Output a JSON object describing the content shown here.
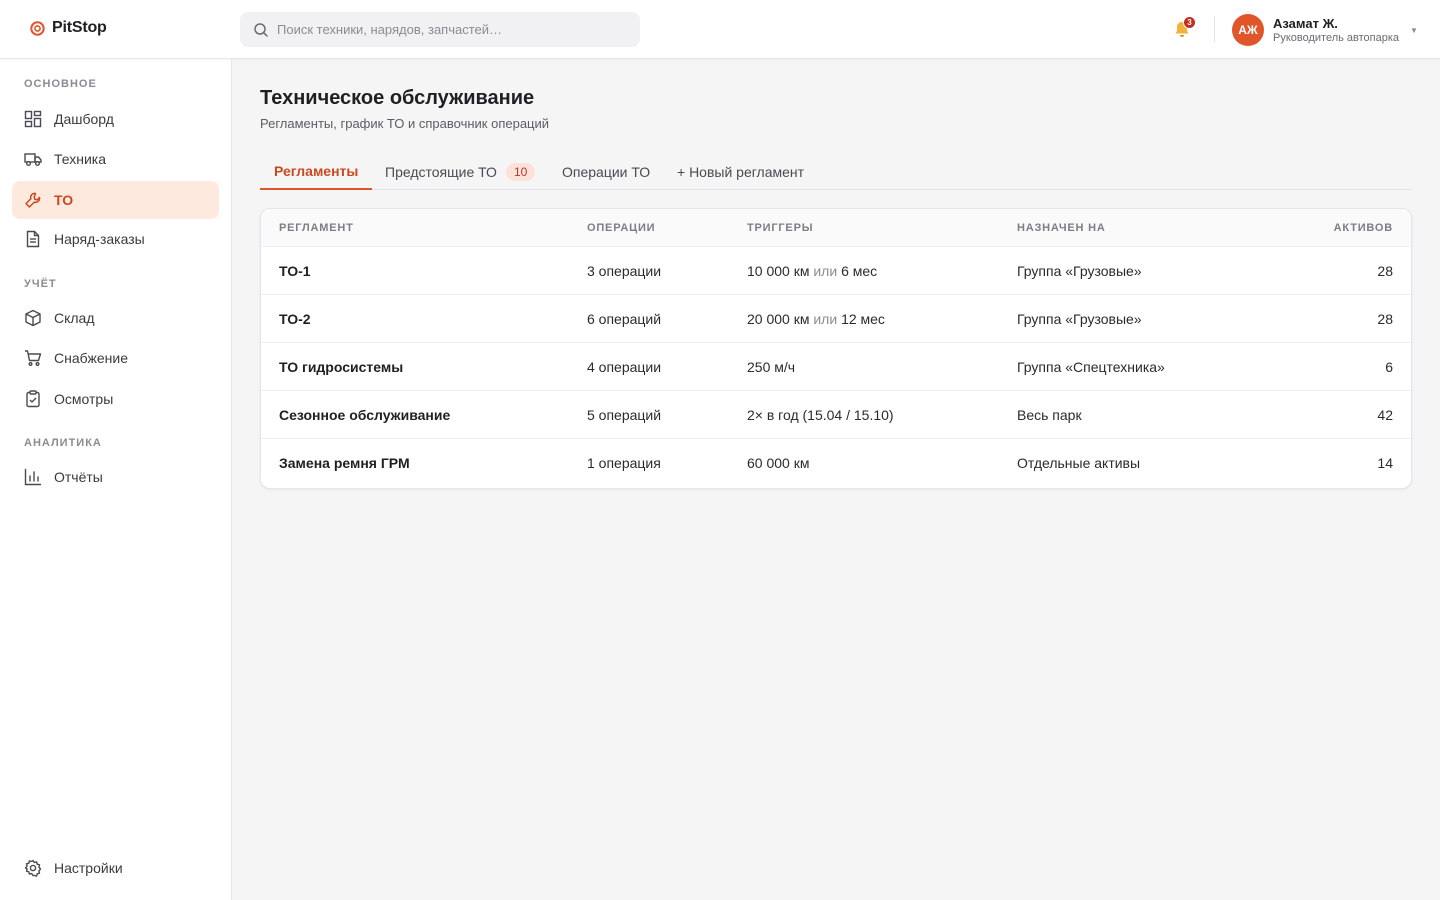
{
  "app": {
    "name": "PitStop",
    "accent": "#E0552A"
  },
  "search": {
    "placeholder": "Поиск техники, нарядов, запчастей…"
  },
  "notifications": {
    "count": "3"
  },
  "user": {
    "initials": "АЖ",
    "name": "Азамат Ж.",
    "role": "Руководитель автопарка"
  },
  "sidebar": {
    "sections": [
      {
        "title": "ОСНОВНОЕ",
        "items": [
          {
            "label": "Дашборд",
            "icon": "dashboard-icon"
          },
          {
            "label": "Техника",
            "icon": "truck-icon"
          },
          {
            "label": "ТО",
            "icon": "wrench-icon",
            "active": true
          },
          {
            "label": "Наряд-заказы",
            "icon": "document-icon"
          }
        ]
      },
      {
        "title": "УЧЁТ",
        "items": [
          {
            "label": "Склад",
            "icon": "box-icon"
          },
          {
            "label": "Снабжение",
            "icon": "cart-icon"
          },
          {
            "label": "Осмотры",
            "icon": "clipboard-check-icon"
          }
        ]
      },
      {
        "title": "АНАЛИТИКА",
        "items": [
          {
            "label": "Отчёты",
            "icon": "bar-chart-icon"
          }
        ]
      }
    ],
    "settings": {
      "label": "Настройки",
      "icon": "gear-icon"
    }
  },
  "page": {
    "title": "Техническое обслуживание",
    "subtitle": "Регламенты, график ТО и справочник операций"
  },
  "tabs": [
    {
      "label": "Регламенты",
      "active": true
    },
    {
      "label": "Предстоящие ТО",
      "badge": "10"
    },
    {
      "label": "Операции ТО"
    },
    {
      "label": "+ Новый регламент"
    }
  ],
  "table": {
    "headers": [
      "РЕГЛАМЕНТ",
      "ОПЕРАЦИИ",
      "ТРИГГЕРЫ",
      "НАЗНАЧЕН НА",
      "АКТИВОВ"
    ],
    "rows": [
      {
        "name": "ТО-1",
        "ops": "3 операции",
        "trigger_a": "10 000 км",
        "trigger_or": "или",
        "trigger_b": "6 мес",
        "assigned": "Группа «Грузовые»",
        "assets": "28"
      },
      {
        "name": "ТО-2",
        "ops": "6 операций",
        "trigger_a": "20 000 км",
        "trigger_or": "или",
        "trigger_b": "12 мес",
        "assigned": "Группа «Грузовые»",
        "assets": "28"
      },
      {
        "name": "ТО гидросистемы",
        "ops": "4 операции",
        "trigger_a": "250 м/ч",
        "trigger_or": "",
        "trigger_b": "",
        "assigned": "Группа «Спецтехника»",
        "assets": "6"
      },
      {
        "name": "Сезонное обслуживание",
        "ops": "5 операций",
        "trigger_a": "2× в год (15.04 / 15.10)",
        "trigger_or": "",
        "trigger_b": "",
        "assigned": "Весь парк",
        "assets": "42"
      },
      {
        "name": "Замена ремня ГРМ",
        "ops": "1 операция",
        "trigger_a": "60 000 км",
        "trigger_or": "",
        "trigger_b": "",
        "assigned": "Отдельные активы",
        "assets": "14"
      }
    ]
  }
}
